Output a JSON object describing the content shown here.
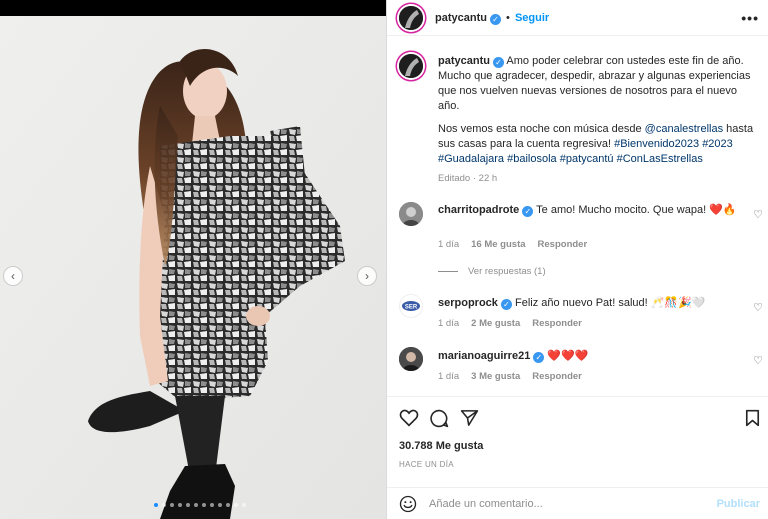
{
  "post": {
    "author": "patycantu",
    "follow_label": "Seguir",
    "more_label": "•••",
    "caption_author": "patycantu",
    "caption_p1": "Amo poder celebrar con ustedes este fin de año. Mucho que agradecer, despedir, abrazar y algunas experiencias que nos vuelven nuevas versiones de nosotros para el nuevo año.",
    "caption_p2_start": "Nos vemos esta noche con música desde ",
    "caption_mention": "@canalestrellas",
    "caption_p2_mid": " hasta sus casas para la cuenta regresiva! ",
    "hashtags": [
      "#Bienvenido2023",
      "#2023",
      "#Guadalajara",
      "#bailosola",
      "#patycantú",
      "#ConLasEstrellas"
    ],
    "edited_label": "Editado · 22 h"
  },
  "comments": [
    {
      "user": "charritopadrote",
      "text": "Te amo! Mucho mocito. Que wapa! ❤️🔥",
      "time": "1 día",
      "likes": "16 Me gusta",
      "reply": "Responder",
      "view_replies": "Ver respuestas (1)"
    },
    {
      "user": "serpoprock",
      "text": "Feliz año nuevo Pat! salud! 🥂🎊🎉🤍",
      "time": "1 día",
      "likes": "2 Me gusta",
      "reply": "Responder"
    },
    {
      "user": "marianoaguirre21",
      "text": "❤️❤️❤️",
      "time": "1 día",
      "likes": "3 Me gusta",
      "reply": "Responder"
    }
  ],
  "footer": {
    "likes": "30.788 Me gusta",
    "ago": "HACE UN DÍA",
    "comment_placeholder": "Añade un comentario...",
    "publish_label": "Publicar"
  },
  "icons": {
    "verified": "verified-badge-icon",
    "heart": "heart-icon",
    "comment": "comment-icon",
    "share": "paper-plane-icon",
    "save": "bookmark-icon",
    "emoji": "emoji-icon",
    "prev": "chevron-left-icon",
    "next": "chevron-right-icon"
  },
  "colors": {
    "accent": "#0095f6",
    "verified": "#3897f0",
    "muted": "#8e8e8e",
    "link": "#00376b"
  },
  "carousel": {
    "slides": 12,
    "active_index": 0
  }
}
